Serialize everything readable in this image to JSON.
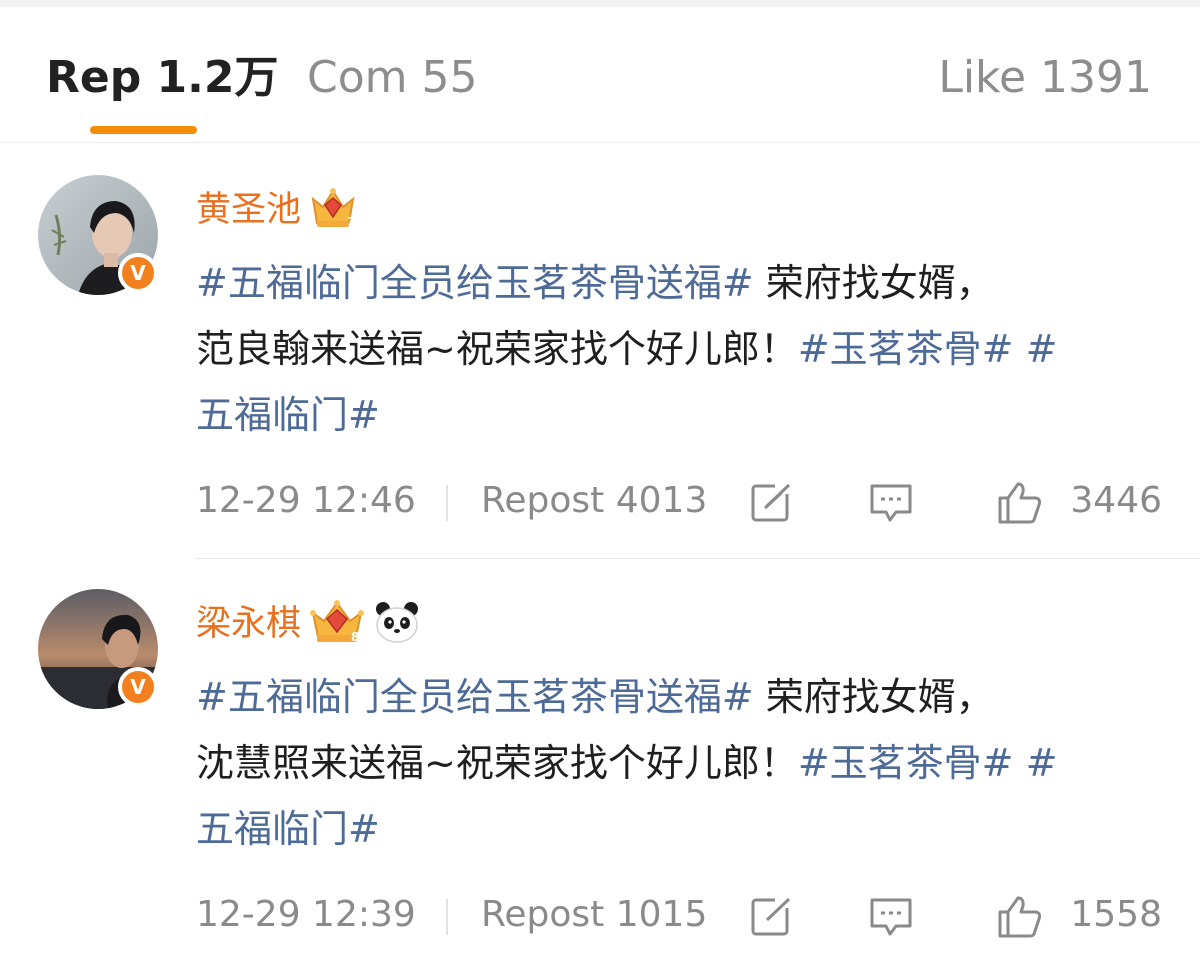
{
  "tabs": {
    "repost": "Rep 1.2万",
    "comment": "Com 55",
    "like": "Like 1391"
  },
  "posts": [
    {
      "username": "黄圣池",
      "badge_icon": "crown-gem-icon",
      "extra_badge_icon": "",
      "verified_label": "V",
      "content_parts": [
        {
          "text": "#五福临门全员给玉茗茶骨送福#",
          "hashtag": true
        },
        {
          "text": " 荣府找女婿，",
          "hashtag": false
        },
        {
          "text": "\n",
          "hashtag": false
        },
        {
          "text": "范良翰来送福~祝荣家找个好儿郎！",
          "hashtag": false
        },
        {
          "text": "#玉茗茶骨#",
          "hashtag": true
        },
        {
          "text": " ",
          "hashtag": false
        },
        {
          "text": "#",
          "hashtag": true
        },
        {
          "text": "\n",
          "hashtag": false
        },
        {
          "text": "五福临门#",
          "hashtag": true
        }
      ],
      "time": "12-29 12:46",
      "repost_label": "Repost 4013",
      "like_count": "3446"
    },
    {
      "username": "梁永棋",
      "badge_icon": "crown-gem-icon",
      "extra_badge_icon": "panda-icon",
      "verified_label": "V",
      "content_parts": [
        {
          "text": "#五福临门全员给玉茗茶骨送福#",
          "hashtag": true
        },
        {
          "text": " 荣府找女婿，",
          "hashtag": false
        },
        {
          "text": "\n",
          "hashtag": false
        },
        {
          "text": "沈慧照来送福~祝荣家找个好儿郎！",
          "hashtag": false
        },
        {
          "text": "#玉茗茶骨#",
          "hashtag": true
        },
        {
          "text": " ",
          "hashtag": false
        },
        {
          "text": "#",
          "hashtag": true
        },
        {
          "text": "\n",
          "hashtag": false
        },
        {
          "text": "五福临门#",
          "hashtag": true
        }
      ],
      "time": "12-29 12:39",
      "repost_label": "Repost 1015",
      "like_count": "1558"
    }
  ],
  "colors": {
    "accent": "#f58d0a",
    "username": "#e8701e",
    "hashtag": "#4e6a96",
    "verified": "#f2801f"
  }
}
